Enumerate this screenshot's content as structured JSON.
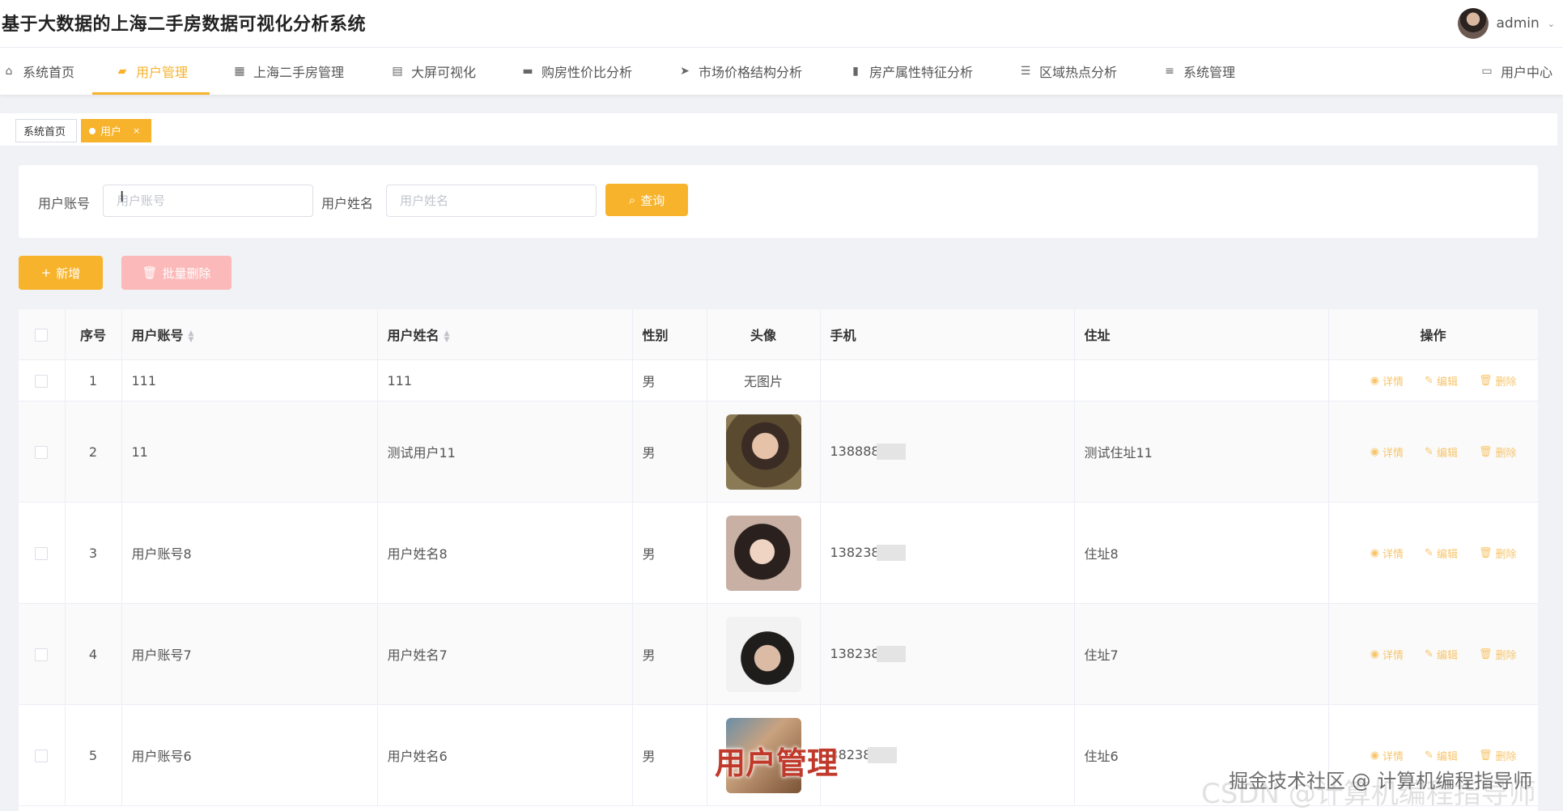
{
  "app": {
    "title": "基于大数据的上海二手房数据可视化分析系统",
    "user": "admin"
  },
  "nav": {
    "items": [
      {
        "label": "系统首页",
        "icon": "home-icon"
      },
      {
        "label": "用户管理",
        "icon": "chat-icon"
      },
      {
        "label": "上海二手房管理",
        "icon": "grid-icon"
      },
      {
        "label": "大屏可视化",
        "icon": "briefcase-icon"
      },
      {
        "label": "购房性价比分析",
        "icon": "toolbox-icon"
      },
      {
        "label": "市场价格结构分析",
        "icon": "send-icon"
      },
      {
        "label": "房产属性特征分析",
        "icon": "stamp-icon"
      },
      {
        "label": "区域热点分析",
        "icon": "sliders-icon"
      },
      {
        "label": "系统管理",
        "icon": "list-icon"
      }
    ],
    "right_item": {
      "label": "用户中心",
      "icon": "calendar-icon"
    }
  },
  "tabs": {
    "home": "系统首页",
    "current": "用户",
    "close": "×"
  },
  "search": {
    "account_label": "用户账号",
    "account_placeholder": "用户账号",
    "name_label": "用户姓名",
    "name_placeholder": "用户姓名",
    "query_label": "查询"
  },
  "actions": {
    "add_label": "新增",
    "batch_delete_label": "批量删除"
  },
  "table": {
    "headers": {
      "index": "序号",
      "account": "用户账号",
      "name": "用户姓名",
      "gender": "性别",
      "avatar": "头像",
      "phone": "手机",
      "address": "住址",
      "ops": "操作"
    },
    "op_labels": {
      "detail": "详情",
      "edit": "编辑",
      "delete": "删除"
    },
    "rows": [
      {
        "index": "1",
        "account": "111",
        "name": "111",
        "gender": "男",
        "avatar_text": "无图片",
        "phone": "",
        "address": ""
      },
      {
        "index": "2",
        "account": "11",
        "name": "测试用户11",
        "gender": "男",
        "avatar_text": "",
        "phone": "138888",
        "address": "测试住址11"
      },
      {
        "index": "3",
        "account": "用户账号8",
        "name": "用户姓名8",
        "gender": "男",
        "avatar_text": "",
        "phone": "138238",
        "address": "住址8"
      },
      {
        "index": "4",
        "account": "用户账号7",
        "name": "用户姓名7",
        "gender": "男",
        "avatar_text": "",
        "phone": "138238",
        "address": "住址7"
      },
      {
        "index": "5",
        "account": "用户账号6",
        "name": "用户姓名6",
        "gender": "男",
        "avatar_text": "",
        "phone": "38238",
        "address": "住址6"
      }
    ]
  },
  "overlay": {
    "title": "用户管理",
    "watermark": "掘金技术社区 @ 计算机编程指导师",
    "watermark_faint": "CSDN @计算机编程指导师"
  },
  "colors": {
    "accent": "#f7b32b",
    "danger_light": "#fbb9b9"
  }
}
